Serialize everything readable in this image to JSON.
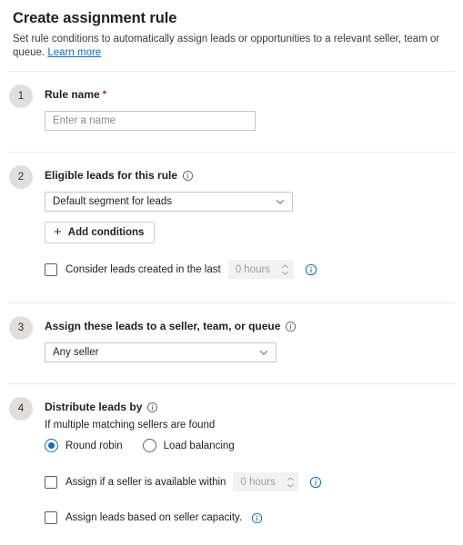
{
  "header": {
    "title": "Create assignment rule",
    "subtitle": "Set rule conditions to automatically assign leads or opportunities to a relevant seller, team or queue.",
    "learn_more": "Learn more"
  },
  "colors": {
    "accent": "#0f6cbd",
    "required_star": "#a4262c",
    "badge_background": "#e1dfdd",
    "border": "#c8c6c4",
    "divider": "#edebe9",
    "disabled_background": "#f3f2f1",
    "disabled_text": "#a19f9d"
  },
  "sections": [
    {
      "number": "1",
      "label": "Rule name",
      "required_marker": "*",
      "input": {
        "value": "",
        "placeholder": "Enter a name"
      }
    },
    {
      "number": "2",
      "label": "Eligible leads for this rule",
      "info_icon": "info-circle-icon",
      "dropdown": {
        "selected": "Default segment for leads",
        "chevron": "chevron-down-icon"
      },
      "add_button": {
        "label": "Add conditions",
        "icon": "plus-icon"
      },
      "checkbox_row": {
        "checked": false,
        "label": "Consider leads created in the last",
        "spinner": {
          "value": "0 hours",
          "disabled": true,
          "icon": "spinner-arrows-icon"
        },
        "info_icon": "info-circle-icon"
      }
    },
    {
      "number": "3",
      "label": "Assign these leads to a seller, team, or queue",
      "info_icon": "info-circle-icon",
      "dropdown": {
        "selected": "Any seller",
        "chevron": "chevron-down-icon"
      }
    },
    {
      "number": "4",
      "label": "Distribute leads by",
      "info_icon": "info-circle-icon",
      "helper_text": "If multiple matching sellers are found",
      "radios": [
        {
          "label": "Round robin",
          "checked": true
        },
        {
          "label": "Load balancing",
          "checked": false
        }
      ],
      "checkbox_rows": [
        {
          "checked": false,
          "label": "Assign if a seller is available within",
          "spinner": {
            "value": "0 hours",
            "disabled": true,
            "icon": "spinner-arrows-icon"
          },
          "info_icon": "info-circle-icon"
        },
        {
          "checked": false,
          "label": "Assign leads based on seller capacity.",
          "info_icon": "info-circle-icon"
        }
      ]
    }
  ]
}
